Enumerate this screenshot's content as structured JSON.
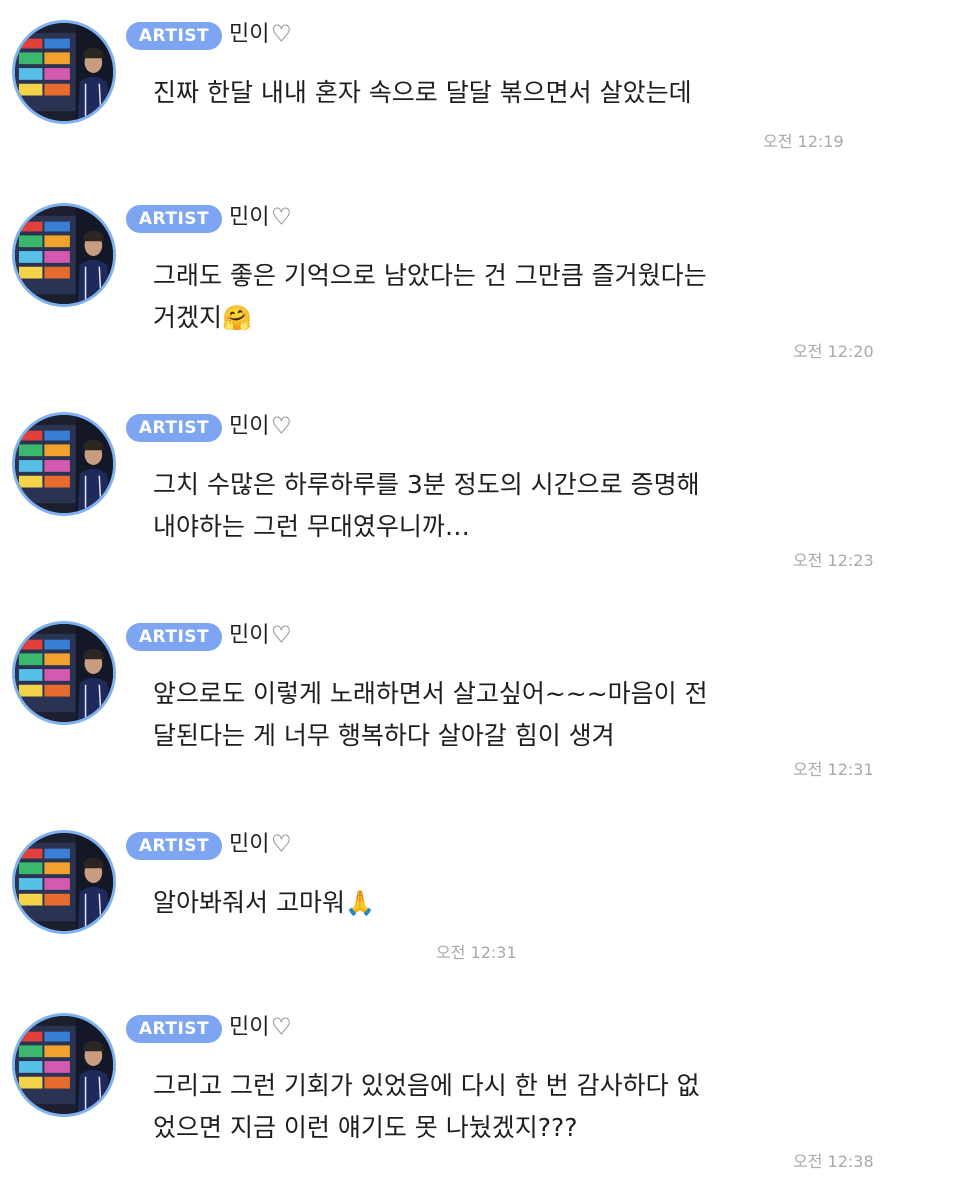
{
  "badge_label": "ARTIST",
  "accent_color": "#7da5f2",
  "messages": [
    {
      "nickname": "민이",
      "nick_icon": "white-heart-icon",
      "text": "진짜 한달 내내 혼자 속으로 달달 볶으면서 살았는데",
      "emoji": "",
      "time": "오전 12:19"
    },
    {
      "nickname": "민이",
      "nick_icon": "white-heart-icon",
      "text": "그래도 좋은 기억으로 남았다는 건 그만큼 즐거웠다는\n거겠지",
      "emoji": "🤗",
      "time": "오전 12:20"
    },
    {
      "nickname": "민이",
      "nick_icon": "white-heart-icon",
      "text": "그치 수많은 하루하루를 3분 정도의 시간으로 증명해\n내야하는 그런 무대였우니까…",
      "emoji": "",
      "time": "오전 12:23"
    },
    {
      "nickname": "민이",
      "nick_icon": "white-heart-icon",
      "text": "앞으로도 이렇게 노래하면서 살고싶어~~~마음이 전\n달된다는 게 너무 행복하다 살아갈 힘이 생겨",
      "emoji": "",
      "time": "오전 12:31"
    },
    {
      "nickname": "민이",
      "nick_icon": "white-heart-icon",
      "text": "알아봐줘서 고마워",
      "emoji": "🙏",
      "time": "오전 12:31"
    },
    {
      "nickname": "민이",
      "nick_icon": "white-heart-icon",
      "text": "그리고 그런 기회가 있었음에 다시 한 번 감사하다 없\n었으면 지금 이런 얘기도 못 나눴겠지???",
      "emoji": "",
      "time": "오전 12:38"
    }
  ]
}
